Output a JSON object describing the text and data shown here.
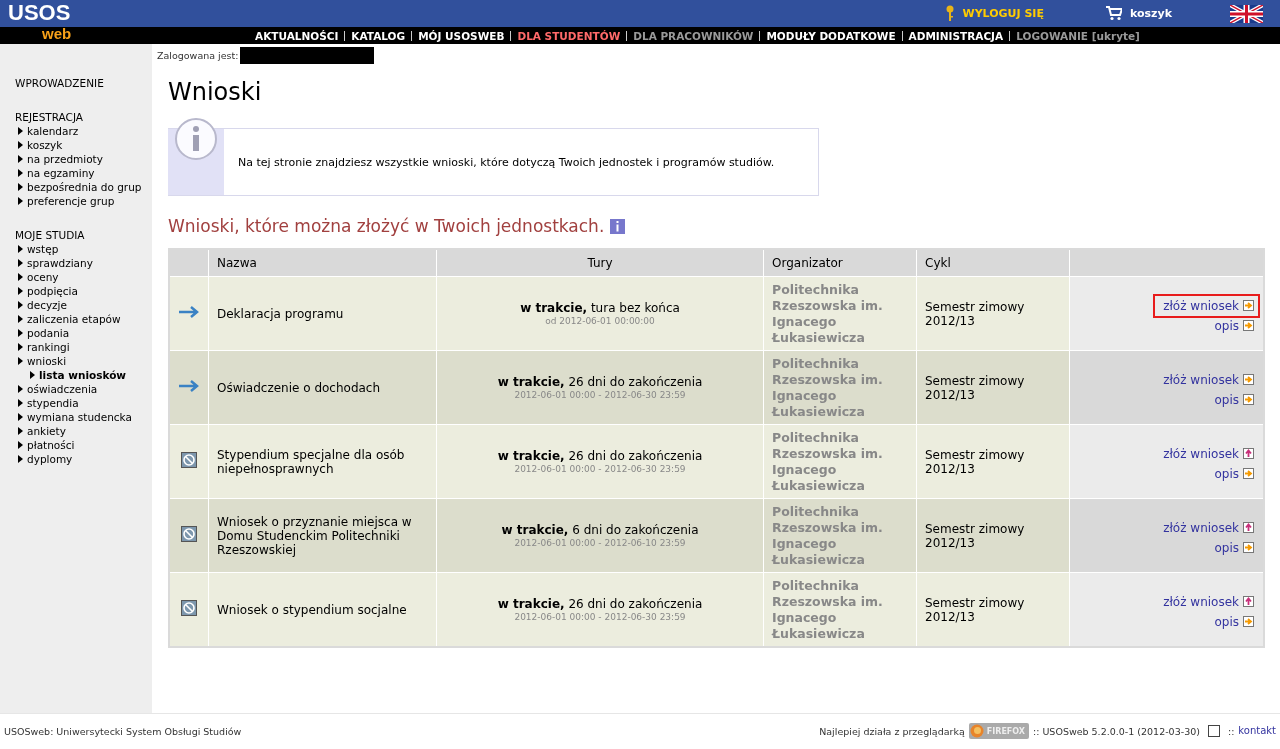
{
  "header": {
    "logo_main": "USOS",
    "logo_sub": "web",
    "logout": "WYLOGUJ SIĘ",
    "cart": "koszyk"
  },
  "nav": [
    {
      "label": "AKTUALNOŚCI",
      "selected": false,
      "disabled": false
    },
    {
      "label": "KATALOG",
      "selected": false,
      "disabled": false
    },
    {
      "label": "MÓJ USOSWEB",
      "selected": false,
      "disabled": false
    },
    {
      "label": "DLA STUDENTÓW",
      "selected": true,
      "disabled": false
    },
    {
      "label": "DLA PRACOWNIKÓW",
      "selected": false,
      "disabled": true
    },
    {
      "label": "MODUŁY DODATKOWE",
      "selected": false,
      "disabled": false
    },
    {
      "label": "ADMINISTRACJA",
      "selected": false,
      "disabled": false
    },
    {
      "label": "LOGOWANIE [ukryte]",
      "selected": false,
      "disabled": true
    }
  ],
  "login": {
    "label": "Zalogowana jest:"
  },
  "sidebar": {
    "sections": [
      {
        "title": "WPROWADZENIE"
      },
      {
        "title": "REJESTRACJA",
        "items": [
          {
            "label": "kalendarz",
            "selected": false
          },
          {
            "label": "koszyk",
            "selected": false
          },
          {
            "label": "na przedmioty",
            "selected": false
          },
          {
            "label": "na egzaminy",
            "selected": false
          },
          {
            "label": "bezpośrednia do grup",
            "selected": false
          },
          {
            "label": "preferencje grup",
            "selected": false
          }
        ]
      },
      {
        "title": "MOJE STUDIA",
        "items": [
          {
            "label": "wstęp",
            "selected": false
          },
          {
            "label": "sprawdziany",
            "selected": false
          },
          {
            "label": "oceny",
            "selected": false
          },
          {
            "label": "podpięcia",
            "selected": false
          },
          {
            "label": "decyzje",
            "selected": false
          },
          {
            "label": "zaliczenia etapów",
            "selected": false
          },
          {
            "label": "podania",
            "selected": false
          },
          {
            "label": "rankingi",
            "selected": false
          },
          {
            "label": "wnioski",
            "selected": false,
            "children": [
              {
                "label": "lista wniosków",
                "selected": true
              }
            ]
          },
          {
            "label": "oświadczenia",
            "selected": false
          },
          {
            "label": "stypendia",
            "selected": false
          },
          {
            "label": "wymiana studencka",
            "selected": false
          },
          {
            "label": "ankiety",
            "selected": false
          },
          {
            "label": "płatności",
            "selected": false
          },
          {
            "label": "dyplomy",
            "selected": false
          }
        ]
      }
    ]
  },
  "page_title": "Wnioski",
  "info_box": {
    "text": "Na tej stronie znajdziesz wszystkie wnioski, które dotyczą Twoich jednostek i programów studiów."
  },
  "section_title": "Wnioski, które można złożyć w Twoich jednostkach.",
  "table": {
    "columns": [
      "Nazwa",
      "Tury",
      "Organizator",
      "Cykl"
    ],
    "rows": [
      {
        "kind": "open",
        "name": "Deklaracja programu",
        "tura": "**w trakcie,** tura bez końca",
        "dates": "od 2012-06-01 00:00:00",
        "organizer": "Politechnika Rzeszowska im. Ignacego Łukasiewicza",
        "cycle": "Semestr zimowy 2012/13",
        "apply": {
          "label": "złóż wniosek",
          "kind": "go",
          "highlighted": true
        },
        "info": "opis"
      },
      {
        "kind": "open",
        "name": "Oświadczenie o dochodach",
        "tura": "**w trakcie,** 26 dni do zakończenia",
        "dates": "2012-06-01 00:00 - 2012-06-30 23:59",
        "organizer": "Politechnika Rzeszowska im. Ignacego Łukasiewicza",
        "cycle": "Semestr zimowy 2012/13",
        "apply": {
          "label": "złóż wniosek",
          "kind": "go",
          "highlighted": false
        },
        "info": "opis"
      },
      {
        "kind": "blocked",
        "name": "Stypendium specjalne dla osób niepełnosprawnych",
        "tura": "**w trakcie,** 26 dni do zakończenia",
        "dates": "2012-06-01 00:00 - 2012-06-30 23:59",
        "organizer": "Politechnika Rzeszowska im. Ignacego Łukasiewicza",
        "cycle": "Semestr zimowy 2012/13",
        "apply": {
          "label": "złóż wniosek",
          "kind": "up",
          "highlighted": false
        },
        "info": "opis"
      },
      {
        "kind": "blocked",
        "name": "Wniosek o przyznanie miejsca w Domu Studenckim Politechniki Rzeszowskiej",
        "tura": "**w trakcie,** 6 dni do zakończenia",
        "dates": "2012-06-01 00:00 - 2012-06-10 23:59",
        "organizer": "Politechnika Rzeszowska im. Ignacego Łukasiewicza",
        "cycle": "Semestr zimowy 2012/13",
        "apply": {
          "label": "złóż wniosek",
          "kind": "up",
          "highlighted": false
        },
        "info": "opis"
      },
      {
        "kind": "blocked",
        "name": "Wniosek o stypendium socjalne",
        "tura": "**w trakcie,** 26 dni do zakończenia",
        "dates": "2012-06-01 00:00 - 2012-06-30 23:59",
        "organizer": "Politechnika Rzeszowska im. Ignacego Łukasiewicza",
        "cycle": "Semestr zimowy 2012/13",
        "apply": {
          "label": "złóż wniosek",
          "kind": "up",
          "highlighted": false
        },
        "info": "opis"
      }
    ]
  },
  "footer": {
    "system": "USOSweb: Uniwersytecki System Obsługi Studiów",
    "best": "Najlepiej działa z przeglądarką",
    "browser": "FIREFOX",
    "version": ":: USOSweb 5.2.0.0-1 (2012-03-30)",
    "checkbox": {
      "checked": false
    },
    "sep": "::",
    "contact": "kontakt"
  }
}
